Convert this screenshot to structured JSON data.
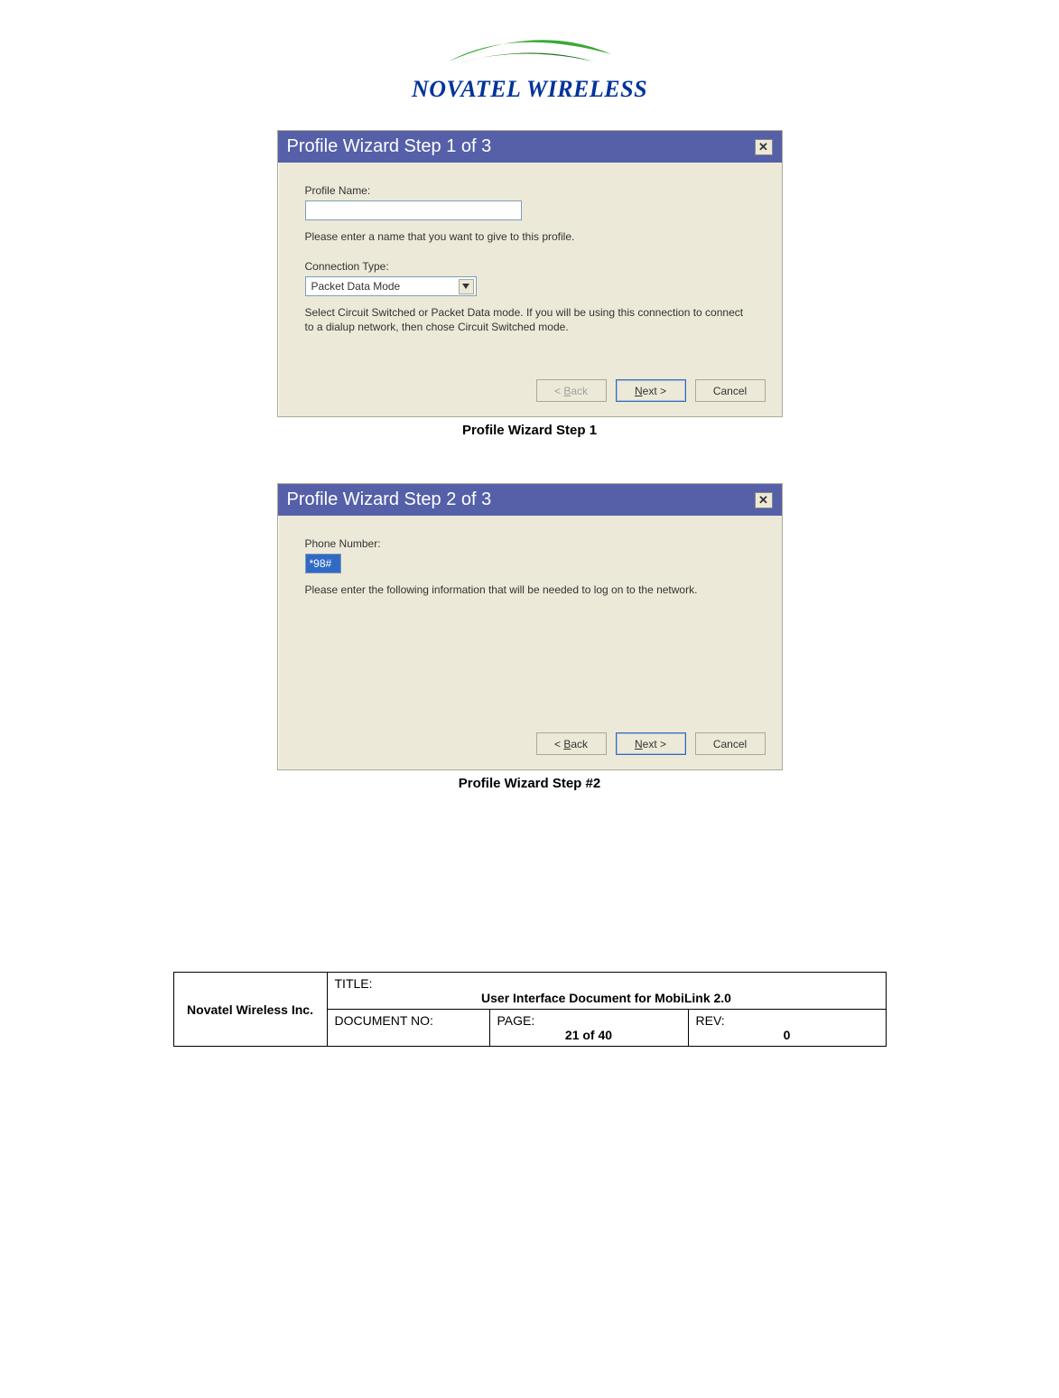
{
  "logo": {
    "text": "NOVATEL WIRELESS"
  },
  "dialog1": {
    "title": "Profile Wizard Step 1 of 3",
    "close_glyph": "✕",
    "profile_name_label": "Profile Name:",
    "profile_name_value": "",
    "profile_name_hint": "Please enter a name that you want to give to this profile.",
    "conn_type_label": "Connection Type:",
    "conn_type_value": "Packet Data Mode",
    "conn_type_hint": "Select Circuit Switched or Packet Data mode.  If you will be using this connection to connect to a dialup network, then chose Circuit Switched mode.",
    "buttons": {
      "back": "< Back",
      "next": "Next >",
      "cancel": "Cancel"
    }
  },
  "caption1": "Profile Wizard Step 1",
  "dialog2": {
    "title": "Profile Wizard Step 2 of 3",
    "close_glyph": "✕",
    "phone_label": "Phone Number:",
    "phone_value": "*98#",
    "phone_hint": "Please enter the following information that will be needed to log on to the network.",
    "buttons": {
      "back": "< Back",
      "next": "Next >",
      "cancel": "Cancel"
    }
  },
  "caption2": "Profile Wizard Step #2",
  "footer": {
    "company": "Novatel Wireless Inc.",
    "title_label": "TITLE:",
    "title_value": "User Interface Document for MobiLink 2.0",
    "docno_label": "DOCUMENT NO:",
    "docno_value": "",
    "page_label": "PAGE:",
    "page_value": "21 of 40",
    "rev_label": "REV:",
    "rev_value": "0"
  }
}
